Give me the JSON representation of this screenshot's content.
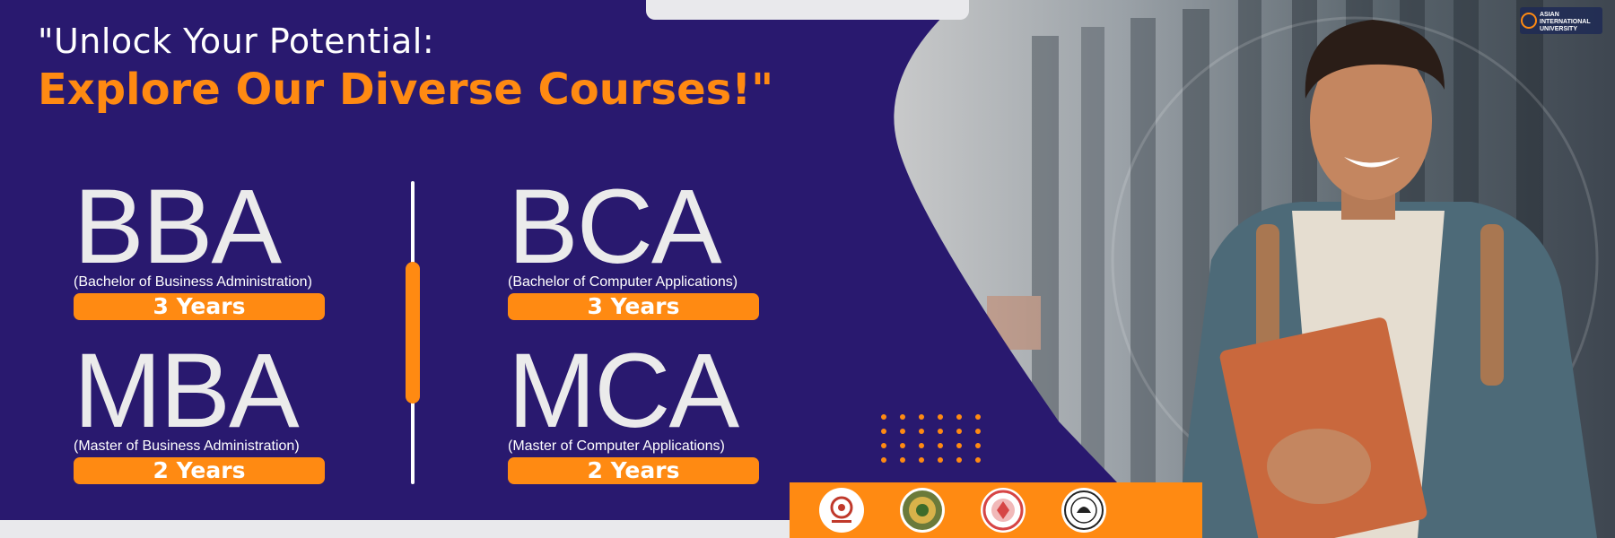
{
  "banner": {
    "headline_line1": "\"Unlock Your Potential:",
    "headline_line2": "Explore Our Diverse Courses!\""
  },
  "courses": [
    {
      "code": "BBA",
      "full_name": "(Bachelor of Business Administration)",
      "duration": "3 Years"
    },
    {
      "code": "BCA",
      "full_name": "(Bachelor of Computer Applications)",
      "duration": "3 Years"
    },
    {
      "code": "MBA",
      "full_name": "(Master of Business Administration)",
      "duration": "2 Years"
    },
    {
      "code": "MCA",
      "full_name": "(Master of Computer Applications)",
      "duration": "2 Years"
    }
  ],
  "logo": {
    "line1": "ASIAN",
    "line2": "INTERNATIONAL",
    "line3": "UNIVERSITY"
  },
  "accreditations": [
    "ugc-seal",
    "state-emblem-seal",
    "government-seal",
    "council-seal"
  ],
  "colors": {
    "background_purple": "#29196f",
    "accent_orange": "#ff8a12",
    "course_text": "#ebebeb"
  }
}
